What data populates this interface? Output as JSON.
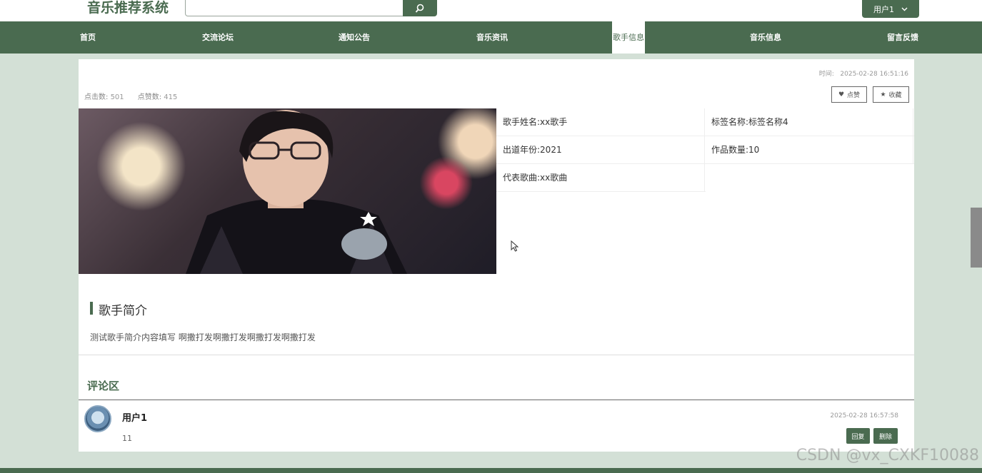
{
  "header": {
    "logo": "音乐推荐系统",
    "search_placeholder": "",
    "user_label": "用户1"
  },
  "nav": {
    "items": [
      {
        "label": "首页"
      },
      {
        "label": "交流论坛"
      },
      {
        "label": "通知公告"
      },
      {
        "label": "音乐资讯"
      },
      {
        "label": "歌手信息"
      },
      {
        "label": "音乐信息"
      },
      {
        "label": "留言反馈"
      }
    ],
    "active": "歌手信息"
  },
  "detail": {
    "time_label": "时间:",
    "time_value": "2025-02-28 16:51:16",
    "clicks_label": "点击数:",
    "clicks_value": "501",
    "likes_label": "点赞数:",
    "likes_value": "415",
    "like_button": "点赞",
    "fav_button": "收藏",
    "info": {
      "singer_name": "歌手姓名:xx歌手",
      "tag_name": "标签名称:标签名称4",
      "debut_year": "出道年份:2021",
      "works_count": "作品数量:10",
      "rep_song": "代表歌曲:xx歌曲"
    },
    "intro_title": "歌手简介",
    "intro_text": "测试歌手简介内容填写 啊撒打发啊撒打发啊撒打发啊撒打发"
  },
  "comments": {
    "title": "评论区",
    "items": [
      {
        "user": "用户1",
        "content": "11",
        "time": "2025-02-28 16:57:58",
        "reply_label": "回复",
        "delete_label": "删除"
      }
    ]
  },
  "watermark": "CSDN @vx_CXKF10088",
  "colors": {
    "accent": "#4a6b50",
    "page_bg": "#d3e0d6"
  }
}
